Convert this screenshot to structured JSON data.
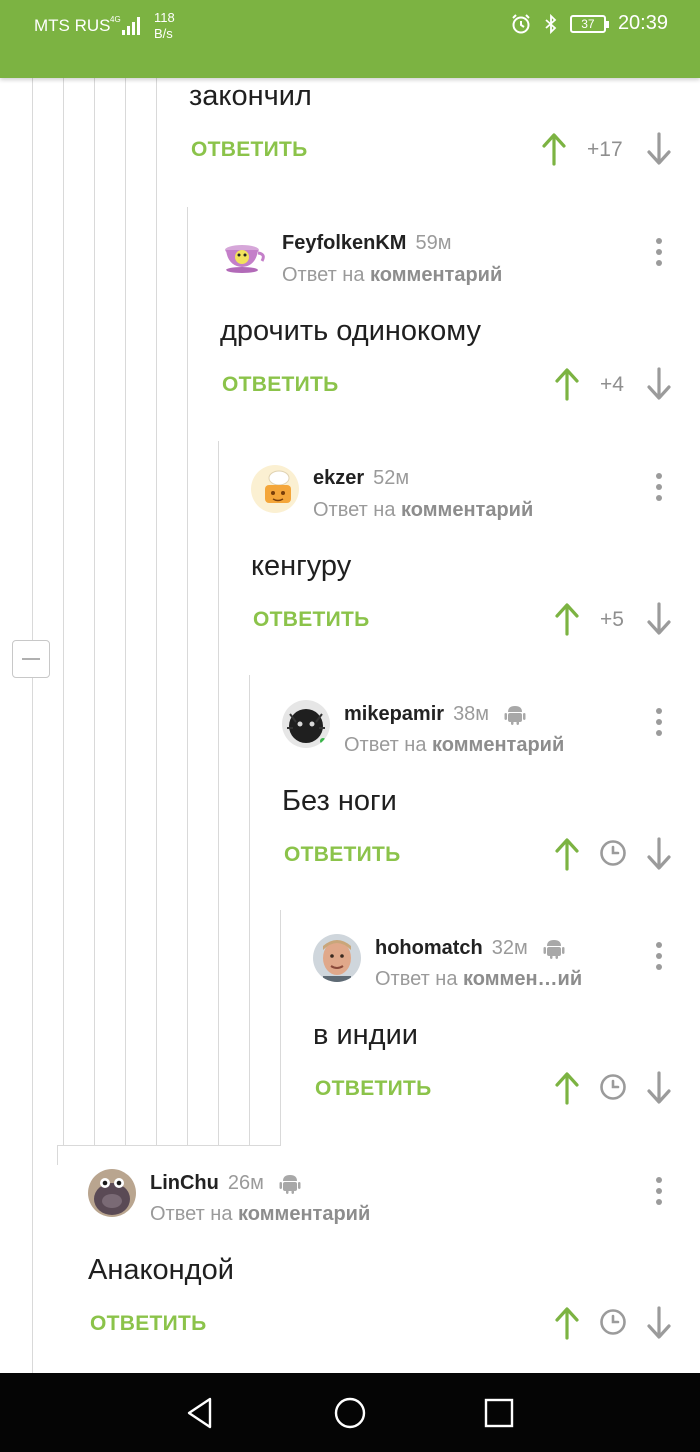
{
  "status_bar": {
    "carrier": "MTS RUS",
    "network": "4G",
    "speed_value": "118",
    "speed_unit": "B/s",
    "battery": "37",
    "time": "20:39",
    "color": "#7cb342"
  },
  "icons": {
    "upvote": "arrow-up",
    "downvote": "arrow-down",
    "more": "vertical-dots",
    "platform": "android",
    "timer": "clock"
  },
  "colors": {
    "accent": "#8bc34a",
    "upvote": "#7cb342",
    "muted": "#9a9a9a"
  },
  "top_comment": {
    "text_tail": "закончил",
    "reply_label": "ОТВЕТИТЬ",
    "score": "+17"
  },
  "comments": [
    {
      "author": "FeyfolkenKM",
      "time": "59м",
      "reply_prefix": "Ответ на",
      "reply_target": "комментарий",
      "text": "дрочить одинокому",
      "reply_label": "ОТВЕТИТЬ",
      "score": "+4"
    },
    {
      "author": "ekzer",
      "time": "52м",
      "reply_prefix": "Ответ на",
      "reply_target": "комментарий",
      "text": "кенгуру",
      "reply_label": "ОТВЕТИТЬ",
      "score": "+5"
    },
    {
      "author": "mikepamir",
      "time": "38м",
      "reply_prefix": "Ответ на",
      "reply_target": "комментарий",
      "text": "Без ноги",
      "reply_label": "ОТВЕТИТЬ"
    },
    {
      "author": "hohomatch",
      "time": "32м",
      "reply_prefix": "Ответ на",
      "reply_target": "коммен…ий",
      "text": "в индии",
      "reply_label": "ОТВЕТИТЬ"
    },
    {
      "author": "LinChu",
      "time": "26м",
      "reply_prefix": "Ответ на",
      "reply_target": "комментарий",
      "text": "Анакондой",
      "reply_label": "ОТВЕТИТЬ"
    }
  ],
  "nav_bar": {
    "back": "back-icon",
    "home": "home-icon",
    "recent": "recent-apps-icon"
  }
}
